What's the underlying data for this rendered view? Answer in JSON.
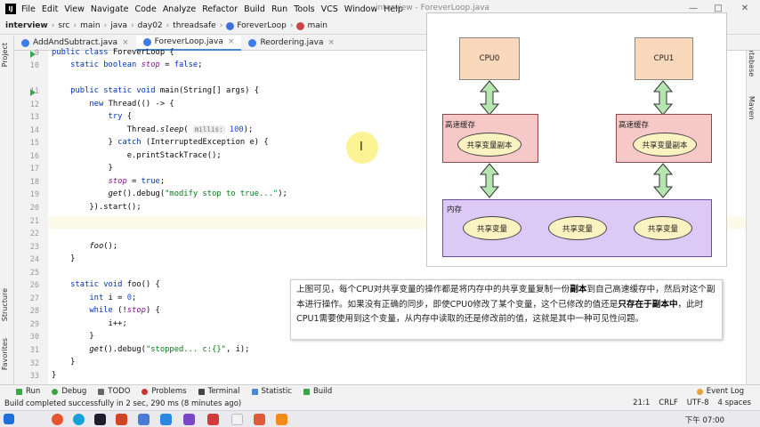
{
  "menubar": {
    "items": [
      "File",
      "Edit",
      "View",
      "Navigate",
      "Code",
      "Analyze",
      "Refactor",
      "Build",
      "Run",
      "Tools",
      "VCS",
      "Window",
      "Help"
    ],
    "window_title": "interview - ForeverLoop.java"
  },
  "navbar": {
    "crumbs": [
      "interview",
      "src",
      "main",
      "java",
      "day02",
      "threadsafe",
      "ForeverLoop",
      "main"
    ]
  },
  "tabs": [
    "AddAndSubtract.java",
    "ForeverLoop.java",
    "Reordering.java"
  ],
  "sidebar": {
    "left": [
      "Project",
      "Structure",
      "Favorites"
    ],
    "right": [
      "Database",
      "Maven"
    ]
  },
  "code": {
    "line_numbers": [
      "9",
      "10",
      "11",
      "12",
      "13",
      "14",
      "15",
      "16",
      "17",
      "18",
      "19",
      "20",
      "21",
      "22",
      "23",
      "24",
      "25",
      "26",
      "27",
      "28",
      "29",
      "30",
      "31",
      "32",
      "33"
    ],
    "l9_a": "public class ",
    "l9_b": "ForeverLoop {",
    "l10_a": "    static boolean ",
    "l10_b": "stop",
    "l10_c": " = ",
    "l10_d": "false",
    "l10_e": ";",
    "l11_a": "    public static void ",
    "l11_b": "main(String[] args) {",
    "l12_a": "        new ",
    "l12_b": "Thread(() -> {",
    "l13_a": "            try",
    "l13_b": " {",
    "l14_a": "                Thread.",
    "l14_b": "sleep",
    "l14_c": "( ",
    "l14_hint": "millis:",
    "l14_d": " 100",
    "l14_e": ");",
    "l15_a": "            } ",
    "l15_b": "catch",
    "l15_c": " (InterruptedException e) {",
    "l16": "                e.printStackTrace();",
    "l17": "            }",
    "l18_a": "            ",
    "l18_b": "stop",
    "l18_c": " = ",
    "l18_d": "true",
    "l18_e": ";",
    "l19_a": "            ",
    "l19_b": "get",
    "l19_c": "().debug(",
    "l19_d": "\"modify stop to true...\"",
    "l19_e": ");",
    "l20": "        }).start();",
    "l23_a": "        ",
    "l23_b": "foo",
    "l23_c": "();",
    "l24": "    }",
    "l26_a": "    static void ",
    "l26_b": "foo() {",
    "l27_a": "        int",
    "l27_b": " i = ",
    "l27_c": "0",
    "l27_d": ";",
    "l28_a": "        while",
    "l28_b": " (!",
    "l28_c": "stop",
    "l28_d": ") {",
    "l29": "            i++;",
    "l30": "        }",
    "l31_a": "        ",
    "l31_b": "get",
    "l31_c": "().debug(",
    "l31_d": "\"stopped... c:{}\"",
    "l31_e": ", i);",
    "l32": "    }",
    "l33": "}"
  },
  "diagram": {
    "cpu0": "CPU0",
    "cpu1": "CPU1",
    "cache_label": "高速缓存",
    "cache_copy": "共享变量副本",
    "memory_label": "内存",
    "shared_var": "共享变量"
  },
  "caption": {
    "p1": "上图可见，每个CPU对共享变量的操作都是将内存中的共享变量复制一份",
    "b1": "副本",
    "p2": "到自己高速缓存中，然后对这个副本进行操作。如果没有正确的同步，即使CPU0修改了某个变量，这个已修改的值还是",
    "b2": "只存在于副本中",
    "p3": "，此时CPU1需要使用到这个变量，从内存中读取的还是修改前的值，这就是其中一种可见性问题。"
  },
  "toolwindows": [
    "Run",
    "Debug",
    "TODO",
    "Problems",
    "Terminal",
    "Statistic",
    "Build"
  ],
  "event_log": "Event Log",
  "status": {
    "message": "Build completed successfully in 2 sec, 290 ms (8 minutes ago)",
    "position": "21:1",
    "line_sep": "CRLF",
    "encoding": "UTF-8",
    "indent": "4 spaces"
  },
  "taskbar": {
    "clock": "下午 07:00"
  },
  "colors": {
    "keyword": "#0033b3",
    "field": "#871094",
    "string": "#067d17",
    "cpu": "#fad8bc",
    "cache": "#f6c8c8",
    "memory": "#dcc9f6",
    "variable": "#fbf2c2"
  }
}
